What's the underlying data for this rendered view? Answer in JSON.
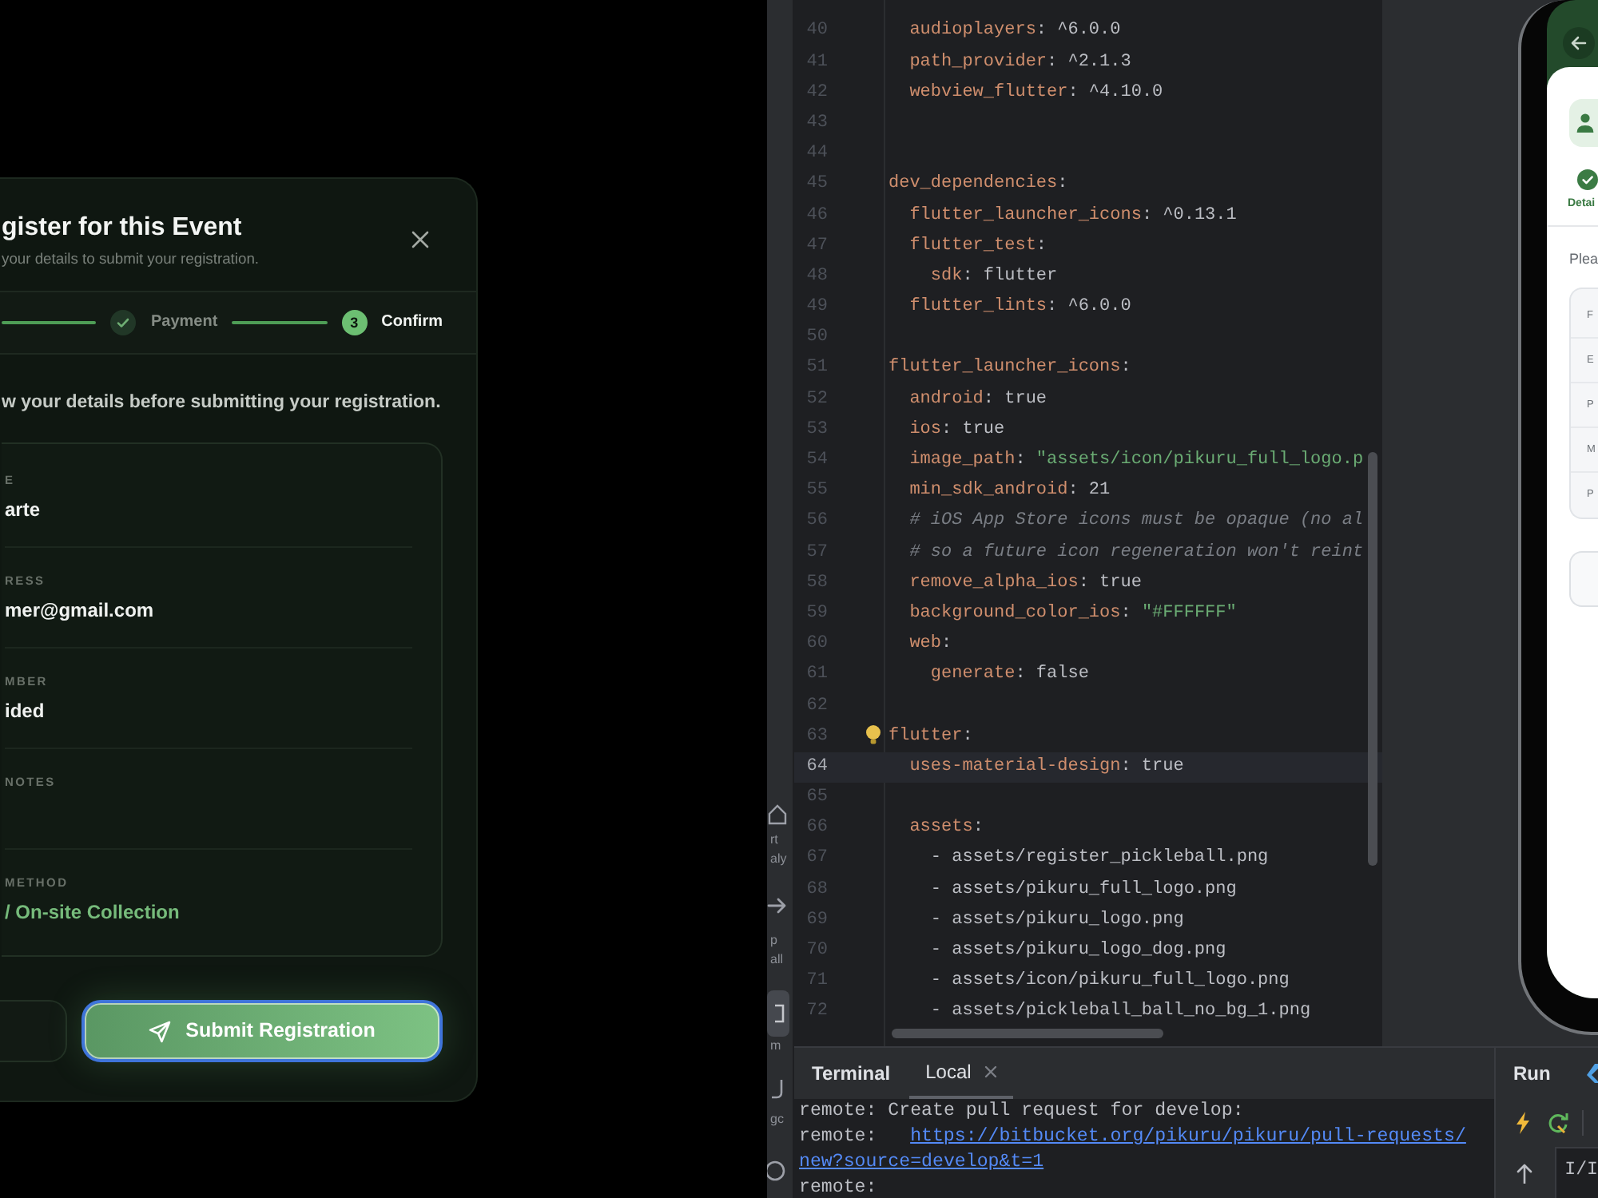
{
  "registration_modal": {
    "title": "gister for this Event",
    "subtitle": "your details to submit your registration.",
    "steps": [
      {
        "done": true,
        "label": "Payment"
      },
      {
        "done": false,
        "number": "3",
        "label": "Confirm"
      }
    ],
    "instruction": "w your details before submitting your registration.",
    "details": [
      {
        "kind": "plain",
        "label": "E",
        "value": "arte"
      },
      {
        "kind": "plain",
        "label": "RESS",
        "value": "mer@gmail.com"
      },
      {
        "kind": "plain",
        "label": "MBER",
        "value": "ided"
      },
      {
        "kind": "plain",
        "label": "NOTES"
      },
      {
        "kind": "accent",
        "label": "METHOD",
        "value": "/ On-site Collection"
      }
    ],
    "buttons": [
      {
        "kind": "secondary",
        "focused": false
      },
      {
        "kind": "primary",
        "label": "Submit Registration",
        "focused": true
      }
    ]
  },
  "tool_strip": {
    "groups": [
      {
        "selected": false,
        "labels": [
          "rt",
          "aly"
        ]
      },
      {
        "selected": false,
        "labels": [
          "p",
          "all"
        ]
      },
      {
        "selected": true,
        "labels": [
          "m"
        ]
      },
      {
        "selected": false,
        "labels": [
          "gc"
        ]
      },
      {
        "selected": false
      }
    ]
  },
  "editor": {
    "lines": [
      {
        "number": "40",
        "current": false,
        "bulb": false,
        "tokens": [
          {
            "kind": "key",
            "text": "  audioplayers"
          },
          {
            "kind": "value",
            "text": ": ^6.0.0"
          }
        ]
      },
      {
        "number": "41",
        "current": false,
        "bulb": false,
        "tokens": [
          {
            "kind": "key",
            "text": "  path_provider"
          },
          {
            "kind": "value",
            "text": ": ^2.1.3"
          }
        ]
      },
      {
        "number": "42",
        "current": false,
        "bulb": false,
        "tokens": [
          {
            "kind": "key",
            "text": "  webview_flutter"
          },
          {
            "kind": "value",
            "text": ": ^4.10.0"
          }
        ]
      },
      {
        "number": "43",
        "current": false,
        "bulb": false
      },
      {
        "number": "44",
        "current": false,
        "bulb": false
      },
      {
        "number": "45",
        "current": false,
        "bulb": false,
        "tokens": [
          {
            "kind": "key",
            "text": "dev_dependencies"
          },
          {
            "kind": "value",
            "text": ":"
          }
        ]
      },
      {
        "number": "46",
        "current": false,
        "bulb": false,
        "tokens": [
          {
            "kind": "key",
            "text": "  flutter_launcher_icons"
          },
          {
            "kind": "value",
            "text": ": ^0.13.1"
          }
        ]
      },
      {
        "number": "47",
        "current": false,
        "bulb": false,
        "tokens": [
          {
            "kind": "key",
            "text": "  flutter_test"
          },
          {
            "kind": "value",
            "text": ":"
          }
        ]
      },
      {
        "number": "48",
        "current": false,
        "bulb": false,
        "tokens": [
          {
            "kind": "key",
            "text": "    sdk"
          },
          {
            "kind": "value",
            "text": ": flutter"
          }
        ]
      },
      {
        "number": "49",
        "current": false,
        "bulb": false,
        "tokens": [
          {
            "kind": "key",
            "text": "  flutter_lints"
          },
          {
            "kind": "value",
            "text": ": ^6.0.0"
          }
        ]
      },
      {
        "number": "50",
        "current": false,
        "bulb": false
      },
      {
        "number": "51",
        "current": false,
        "bulb": false,
        "tokens": [
          {
            "kind": "key",
            "text": "flutter_launcher_icons"
          },
          {
            "kind": "value",
            "text": ":"
          }
        ]
      },
      {
        "number": "52",
        "current": false,
        "bulb": false,
        "tokens": [
          {
            "kind": "key",
            "text": "  android"
          },
          {
            "kind": "value",
            "text": ": true"
          }
        ]
      },
      {
        "number": "53",
        "current": false,
        "bulb": false,
        "tokens": [
          {
            "kind": "key",
            "text": "  ios"
          },
          {
            "kind": "value",
            "text": ": true"
          }
        ]
      },
      {
        "number": "54",
        "current": false,
        "bulb": false,
        "tokens": [
          {
            "kind": "key",
            "text": "  image_path"
          },
          {
            "kind": "value",
            "text": ": "
          },
          {
            "kind": "string",
            "text": "\"assets/icon/pikuru_full_logo.p"
          }
        ]
      },
      {
        "number": "55",
        "current": false,
        "bulb": false,
        "tokens": [
          {
            "kind": "key",
            "text": "  min_sdk_android"
          },
          {
            "kind": "value",
            "text": ": 21"
          }
        ]
      },
      {
        "number": "56",
        "current": false,
        "bulb": false,
        "tokens": [
          {
            "kind": "comment",
            "text": "  # iOS App Store icons must be opaque (no al"
          }
        ]
      },
      {
        "number": "57",
        "current": false,
        "bulb": false,
        "tokens": [
          {
            "kind": "comment",
            "text": "  # so a future icon regeneration won't reint"
          }
        ]
      },
      {
        "number": "58",
        "current": false,
        "bulb": false,
        "tokens": [
          {
            "kind": "key",
            "text": "  remove_alpha_ios"
          },
          {
            "kind": "value",
            "text": ": true"
          }
        ]
      },
      {
        "number": "59",
        "current": false,
        "bulb": false,
        "tokens": [
          {
            "kind": "key",
            "text": "  background_color_ios"
          },
          {
            "kind": "value",
            "text": ": "
          },
          {
            "kind": "string",
            "text": "\"#FFFFFF\""
          }
        ]
      },
      {
        "number": "60",
        "current": false,
        "bulb": false,
        "tokens": [
          {
            "kind": "key",
            "text": "  web"
          },
          {
            "kind": "value",
            "text": ":"
          }
        ]
      },
      {
        "number": "61",
        "current": false,
        "bulb": false,
        "tokens": [
          {
            "kind": "key",
            "text": "    generate"
          },
          {
            "kind": "value",
            "text": ": false"
          }
        ]
      },
      {
        "number": "62",
        "current": false,
        "bulb": false
      },
      {
        "number": "63",
        "current": false,
        "bulb": true,
        "tokens": [
          {
            "kind": "key",
            "text": "flutter"
          },
          {
            "kind": "value",
            "text": ":"
          }
        ]
      },
      {
        "number": "64",
        "current": true,
        "bulb": false,
        "tokens": [
          {
            "kind": "key",
            "text": "  uses-material-design"
          },
          {
            "kind": "value",
            "text": ": true"
          }
        ]
      },
      {
        "number": "65",
        "current": false,
        "bulb": false
      },
      {
        "number": "66",
        "current": false,
        "bulb": false,
        "tokens": [
          {
            "kind": "key",
            "text": "  assets"
          },
          {
            "kind": "value",
            "text": ":"
          }
        ]
      },
      {
        "number": "67",
        "current": false,
        "bulb": false,
        "tokens": [
          {
            "kind": "value",
            "text": "    - assets/register_pickleball.png"
          }
        ]
      },
      {
        "number": "68",
        "current": false,
        "bulb": false,
        "tokens": [
          {
            "kind": "value",
            "text": "    - assets/pikuru_full_logo.png"
          }
        ]
      },
      {
        "number": "69",
        "current": false,
        "bulb": false,
        "tokens": [
          {
            "kind": "value",
            "text": "    - assets/pikuru_logo.png"
          }
        ]
      },
      {
        "number": "70",
        "current": false,
        "bulb": false,
        "tokens": [
          {
            "kind": "value",
            "text": "    - assets/pikuru_logo_dog.png"
          }
        ]
      },
      {
        "number": "71",
        "current": false,
        "bulb": false,
        "tokens": [
          {
            "kind": "value",
            "text": "    - assets/icon/pikuru_full_logo.png"
          }
        ]
      },
      {
        "number": "72",
        "current": false,
        "bulb": false,
        "tokens": [
          {
            "kind": "value",
            "text": "    - assets/pickleball_ball_no_bg_1.png"
          }
        ]
      }
    ]
  },
  "emulator": {
    "step": {
      "label": "Detai",
      "done": true
    },
    "prompt": "Plea",
    "fields": [
      "F",
      "E",
      "P",
      "M",
      "P"
    ]
  },
  "terminal": {
    "title": "Terminal",
    "tabs": [
      {
        "label": "Local",
        "selected": true
      }
    ],
    "lines": [
      {
        "segments": [
          {
            "kind": "text",
            "text": "remote: Create pull request for develop:"
          }
        ]
      },
      {
        "segments": [
          {
            "kind": "text",
            "text": "remote:"
          },
          {
            "kind": "link",
            "text": "https://bitbucket.org/pikuru/pikuru/pull-requests/"
          }
        ]
      },
      {
        "segments": [
          {
            "kind": "link",
            "text": "new?source=develop&t=1"
          }
        ]
      },
      {
        "segments": [
          {
            "kind": "text",
            "text": "remote:"
          }
        ]
      }
    ]
  },
  "run_panel": {
    "title": "Run",
    "log": "I/I"
  }
}
